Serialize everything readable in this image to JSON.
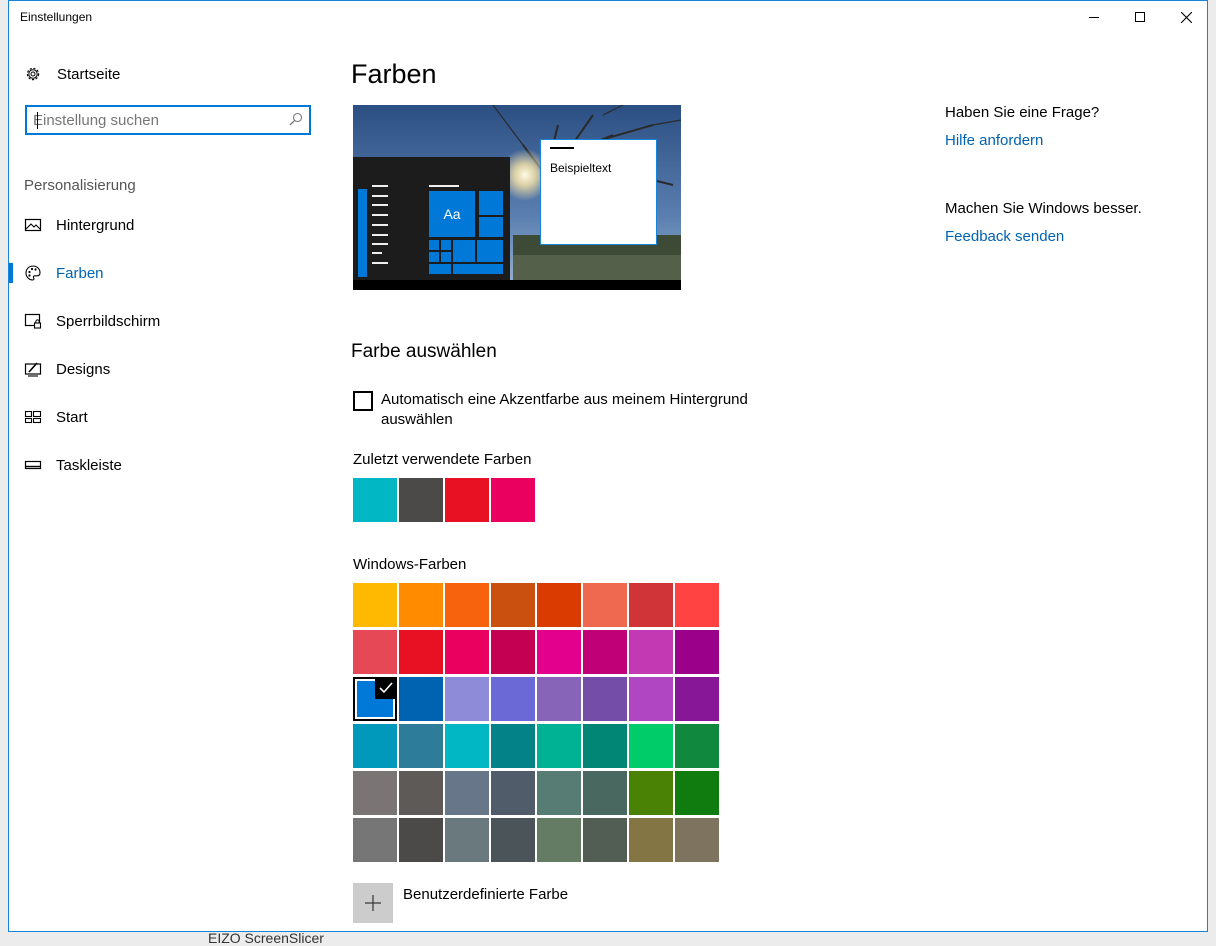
{
  "window": {
    "title": "Einstellungen",
    "controls": {
      "minimize": "minimize",
      "maximize": "maximize",
      "close": "close"
    }
  },
  "sidebar": {
    "home_label": "Startseite",
    "search_placeholder": "Einstellung suchen",
    "section_label": "Personalisierung",
    "items": [
      {
        "label": "Hintergrund",
        "icon": "picture-icon",
        "active": false
      },
      {
        "label": "Farben",
        "icon": "palette-icon",
        "active": true
      },
      {
        "label": "Sperrbildschirm",
        "icon": "lock-screen-icon",
        "active": false
      },
      {
        "label": "Designs",
        "icon": "themes-icon",
        "active": false
      },
      {
        "label": "Start",
        "icon": "start-icon",
        "active": false
      },
      {
        "label": "Taskleiste",
        "icon": "taskbar-icon",
        "active": false
      }
    ]
  },
  "main": {
    "page_title": "Farben",
    "preview": {
      "tile_label": "Aa",
      "sample_text": "Beispieltext"
    },
    "choose_color_title": "Farbe auswählen",
    "auto_accent": {
      "label": "Automatisch eine Akzentfarbe aus meinem Hintergrund auswählen",
      "checked": false
    },
    "recent_title": "Zuletzt verwendete Farben",
    "recent_colors": [
      "#00b7c3",
      "#4c4a48",
      "#e81123",
      "#ea005e"
    ],
    "windows_colors_title": "Windows-Farben",
    "windows_colors": [
      [
        "#ffb900",
        "#ff8c00",
        "#f7630c",
        "#ca5010",
        "#da3b01",
        "#ef6950",
        "#d13438",
        "#ff4343"
      ],
      [
        "#e74856",
        "#e81123",
        "#ea005e",
        "#c30052",
        "#e3008c",
        "#bf0077",
        "#c239b3",
        "#9a0089"
      ],
      [
        "#0078d7",
        "#0063b1",
        "#8e8cd8",
        "#6b69d6",
        "#8764b8",
        "#744da9",
        "#b146c2",
        "#881798"
      ],
      [
        "#0099bc",
        "#2d7d9a",
        "#00b7c3",
        "#038387",
        "#00b294",
        "#018574",
        "#00cc6a",
        "#10893e"
      ],
      [
        "#7a7574",
        "#5d5a58",
        "#68768a",
        "#515c6b",
        "#567c73",
        "#486860",
        "#498205",
        "#107c10"
      ],
      [
        "#767676",
        "#4c4a48",
        "#69797e",
        "#4a5459",
        "#647c64",
        "#525e54",
        "#847545",
        "#7e735f"
      ]
    ],
    "selected_color": "#0078d7",
    "custom_color_label": "Benutzerdefinierte Farbe"
  },
  "help": {
    "question": "Haben Sie eine Frage?",
    "help_link": "Hilfe anfordern",
    "improve": "Machen Sie Windows besser.",
    "feedback_link": "Feedback senden"
  },
  "background_app_text": "EIZO ScreenSlicer"
}
